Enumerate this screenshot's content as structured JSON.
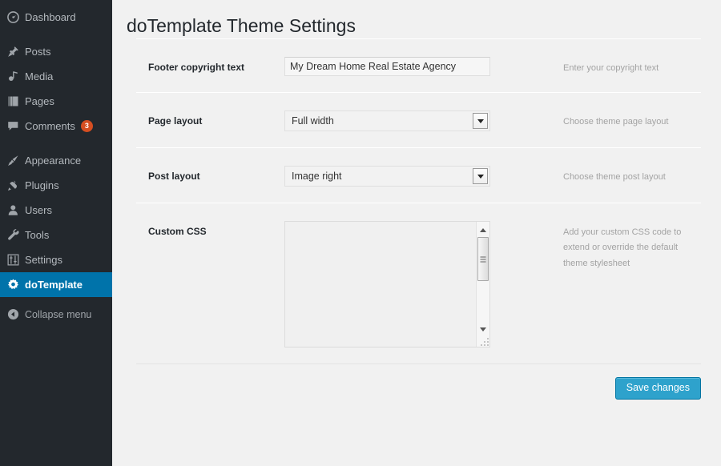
{
  "colors": {
    "sidebar_bg": "#23282d",
    "sidebar_active": "#0073aa",
    "badge": "#d54e21",
    "button_primary": "#2ea2cc",
    "content_bg": "#f1f1f1"
  },
  "sidebar": {
    "items": [
      {
        "label": "Dashboard",
        "icon": "dashboard-icon",
        "active": false,
        "badge": null
      },
      {
        "label": "Posts",
        "icon": "pin-icon",
        "active": false,
        "badge": null
      },
      {
        "label": "Media",
        "icon": "media-icon",
        "active": false,
        "badge": null
      },
      {
        "label": "Pages",
        "icon": "pages-icon",
        "active": false,
        "badge": null
      },
      {
        "label": "Comments",
        "icon": "comment-icon",
        "active": false,
        "badge": "3"
      },
      {
        "label": "Appearance",
        "icon": "paintbrush-icon",
        "active": false,
        "badge": null
      },
      {
        "label": "Plugins",
        "icon": "plug-icon",
        "active": false,
        "badge": null
      },
      {
        "label": "Users",
        "icon": "user-icon",
        "active": false,
        "badge": null
      },
      {
        "label": "Tools",
        "icon": "wrench-icon",
        "active": false,
        "badge": null
      },
      {
        "label": "Settings",
        "icon": "sliders-icon",
        "active": false,
        "badge": null
      },
      {
        "label": "doTemplate",
        "icon": "gear-icon",
        "active": true,
        "badge": null
      }
    ],
    "collapse": {
      "label": "Collapse menu",
      "icon": "collapse-arrow-icon"
    }
  },
  "header": {
    "title": "doTemplate Theme Settings"
  },
  "form": {
    "rows": [
      {
        "label": "Footer copyright text",
        "type": "text",
        "value": "My Dream Home Real Estate Agency",
        "placeholder": "",
        "help": "Enter your copyright text"
      },
      {
        "label": "Page layout",
        "type": "select",
        "value": "Full width",
        "help": "Choose theme page layout"
      },
      {
        "label": "Post layout",
        "type": "select",
        "value": "Image right",
        "help": "Choose theme post layout"
      },
      {
        "label": "Custom CSS",
        "type": "textarea",
        "value": "",
        "placeholder": "",
        "help": "Add your custom CSS code to extend or override the default theme stylesheet"
      }
    ],
    "save_label": "Save changes"
  }
}
